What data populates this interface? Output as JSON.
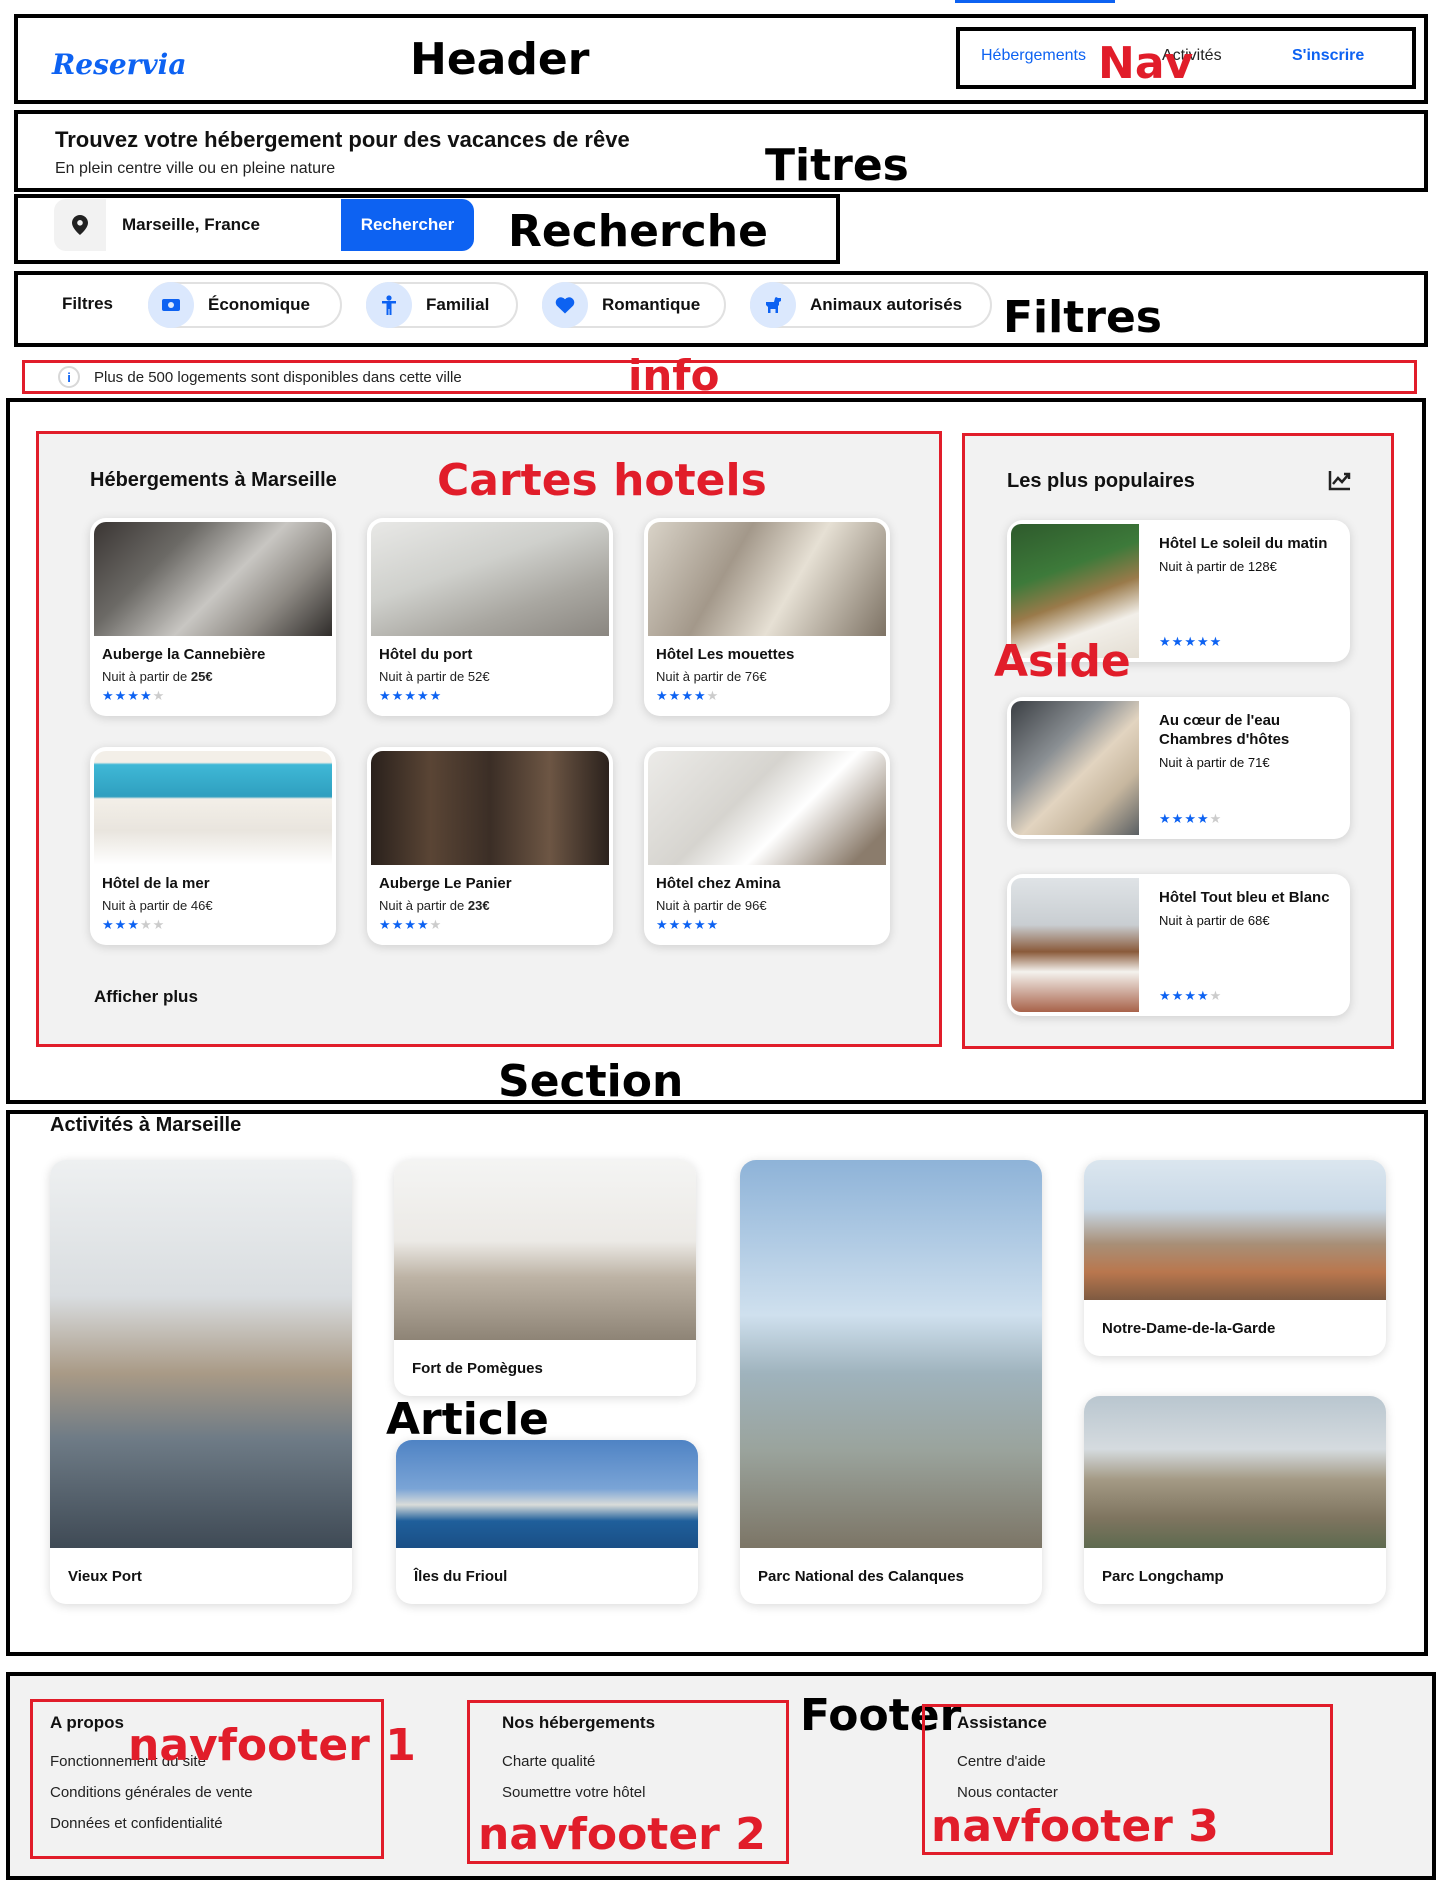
{
  "header": {
    "logo": "Reservia",
    "nav": [
      "Hébergements",
      "Activités",
      "S'inscrire"
    ]
  },
  "titles": {
    "h1": "Trouvez votre hébergement pour des vacances de rêve",
    "sub": "En plein centre ville ou en pleine nature"
  },
  "search": {
    "value": "Marseille, France",
    "button": "Rechercher",
    "icon": "location-pin-icon"
  },
  "filters": {
    "label": "Filtres",
    "items": [
      {
        "label": "Économique",
        "icon": "money-icon"
      },
      {
        "label": "Familial",
        "icon": "child-icon"
      },
      {
        "label": "Romantique",
        "icon": "heart-icon"
      },
      {
        "label": "Animaux autorisés",
        "icon": "dog-icon"
      }
    ]
  },
  "info": {
    "text": "Plus de 500 logements sont disponibles dans cette ville",
    "icon": "info-icon"
  },
  "hotels": {
    "title": "Hébergements à Marseille",
    "more": "Afficher plus",
    "price_prefix": "Nuit à partir de ",
    "items": [
      {
        "name": "Auberge la Cannebière",
        "price": "25€",
        "stars": 4
      },
      {
        "name": "Hôtel du port",
        "price": "52€",
        "stars": 5
      },
      {
        "name": "Hôtel Les mouettes",
        "price": "76€",
        "stars": 4
      },
      {
        "name": "Hôtel de la mer",
        "price": "46€",
        "stars": 3
      },
      {
        "name": "Auberge Le Panier",
        "price": "23€",
        "stars": 4
      },
      {
        "name": "Hôtel chez Amina",
        "price": "96€",
        "stars": 5
      }
    ]
  },
  "popular": {
    "title": "Les plus populaires",
    "icon": "trending-up-icon",
    "items": [
      {
        "name": "Hôtel Le soleil du matin",
        "price": "Nuit à partir de 128€",
        "stars": 5
      },
      {
        "name": "Au cœur de l'eau Chambres d'hôtes",
        "price": "Nuit à partir de 71€",
        "stars": 4
      },
      {
        "name": "Hôtel Tout bleu et Blanc",
        "price": "Nuit à partir de 68€",
        "stars": 4
      }
    ]
  },
  "activities": {
    "title": "Activités à Marseille",
    "items": [
      "Vieux Port",
      "Fort de Pomègues",
      "Îles du Frioul",
      "Parc National des Calanques",
      "Notre-Dame-de-la-Garde",
      "Parc Longchamp"
    ]
  },
  "footer": {
    "cols": [
      {
        "title": "A propos",
        "links": [
          "Fonctionnement du site",
          "Conditions générales de vente",
          "Données et confidentialité"
        ]
      },
      {
        "title": "Nos hébergements",
        "links": [
          "Charte qualité",
          "Soumettre votre hôtel"
        ]
      },
      {
        "title": "Assistance",
        "links": [
          "Centre d'aide",
          "Nous contacter"
        ]
      }
    ]
  },
  "annotations": {
    "header": "Header",
    "nav": "Nav",
    "titres": "Titres",
    "recherche": "Recherche",
    "filtres": "Filtres",
    "info": "info",
    "cartes": "Cartes hotels",
    "aside": "Aside",
    "section": "Section",
    "article": "Article",
    "footer": "Footer",
    "navfooter1": "navfooter 1",
    "navfooter2": "navfooter 2",
    "navfooter3": "navfooter 3"
  },
  "colors": {
    "accent": "#0d62f2",
    "annotation_red": "#e11d2a",
    "panel_bg": "#f2f2f2"
  }
}
